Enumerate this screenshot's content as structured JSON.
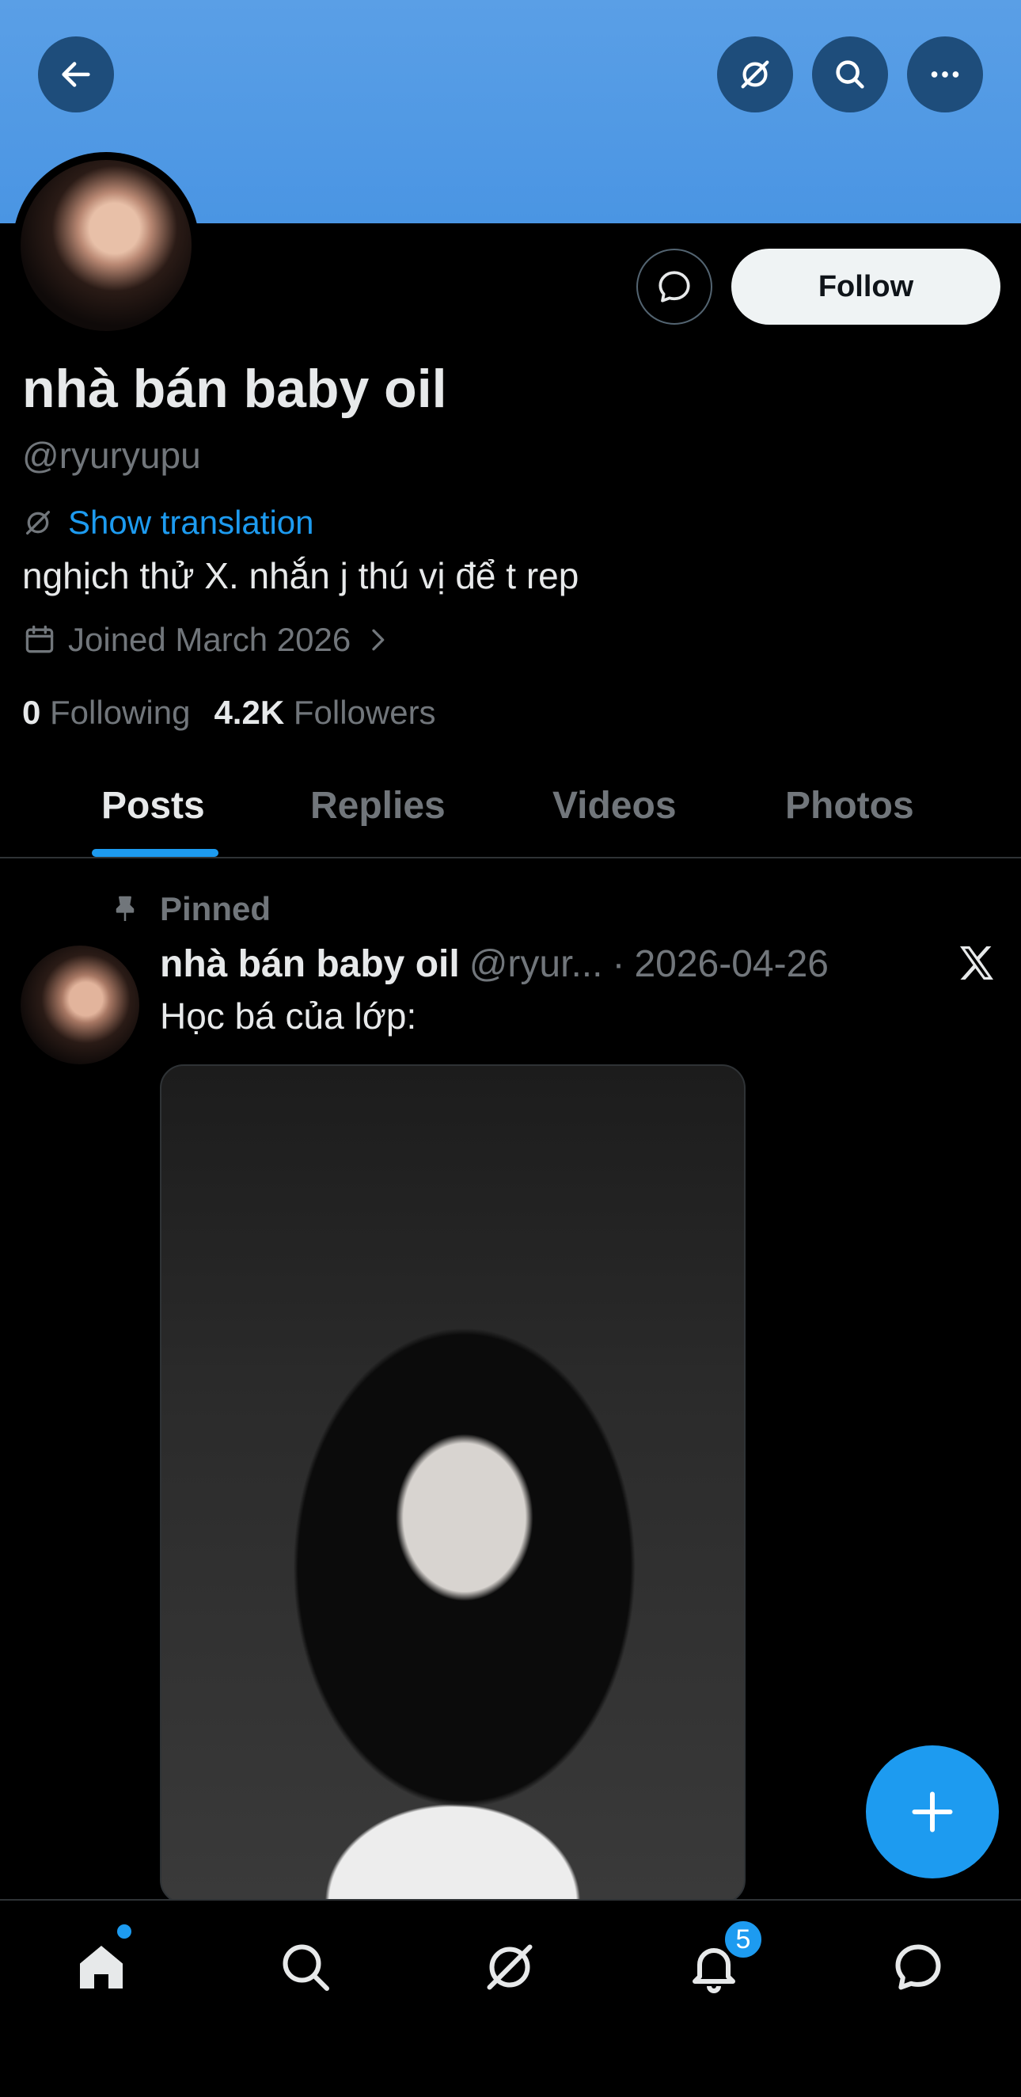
{
  "header": {
    "back_icon": "arrow-left-icon",
    "grok_icon": "grok-icon",
    "search_icon": "search-icon",
    "more_icon": "more-icon",
    "banner_color": "#4a95e3"
  },
  "profile": {
    "follow_label": "Follow",
    "name": "nhà bán baby oil",
    "handle": "@ryuryupu",
    "translate_label": "Show translation",
    "bio": "nghịch thử X. nhắn j thú vị để t rep",
    "joined": "Joined March 2026",
    "following_count": "0",
    "following_label": "Following",
    "followers_count": "4.2K",
    "followers_label": "Followers"
  },
  "tabs": [
    {
      "label": "Posts",
      "active": true
    },
    {
      "label": "Replies",
      "active": false
    },
    {
      "label": "Videos",
      "active": false
    },
    {
      "label": "Photos",
      "active": false
    }
  ],
  "post": {
    "pinned_label": "Pinned",
    "author_name": "nhà bán baby oil",
    "author_handle": "@ryur...",
    "separator": "·",
    "date": "2026-04-26",
    "text": "Học bá của lớp:"
  },
  "bottom_nav": {
    "items": [
      "home-icon",
      "search-icon",
      "grok-icon",
      "notifications-icon",
      "messages-icon"
    ],
    "notification_badge": "5",
    "accent": "#1d9bf0"
  }
}
